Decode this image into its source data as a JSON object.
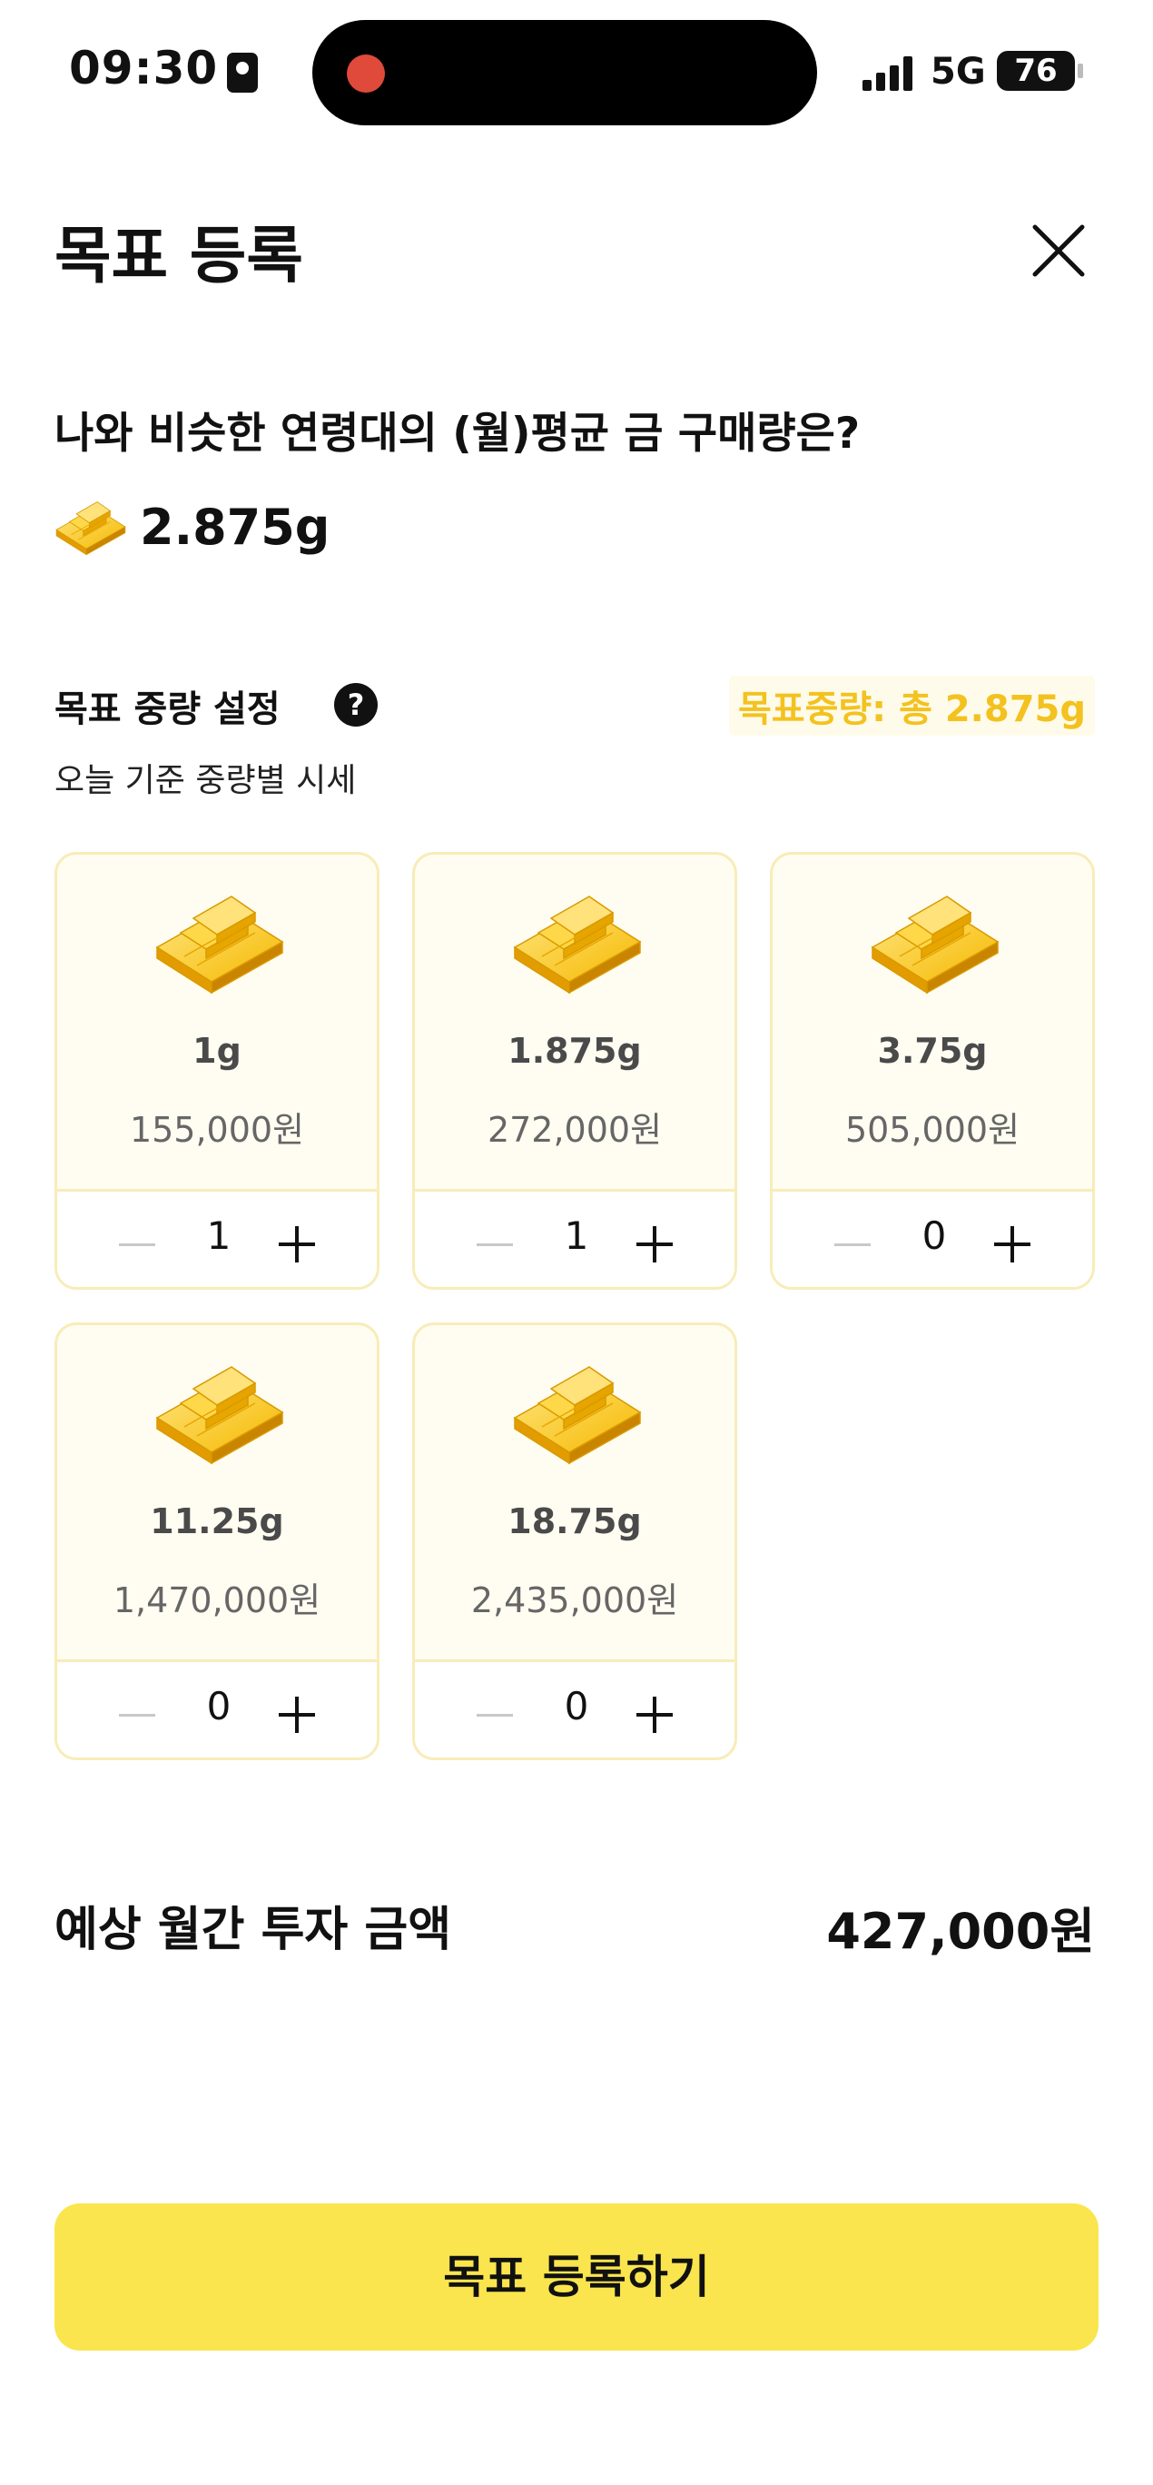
{
  "status_bar": {
    "time": "09:30",
    "network": "5G",
    "battery": "76"
  },
  "header": {
    "title": "목표 등록",
    "close_icon": "close-icon"
  },
  "average": {
    "question": "나와 비슷한 연령대의 (월)평균 금 구매량은?",
    "value": "2.875g"
  },
  "target": {
    "label": "목표 중량 설정",
    "help_icon": "?",
    "total": "목표중량: 총 2.875g",
    "subtitle": "오늘 기준 중량별 시세"
  },
  "items": [
    {
      "weight": "1g",
      "price": "155,000원",
      "quantity": "1"
    },
    {
      "weight": "1.875g",
      "price": "272,000원",
      "quantity": "1"
    },
    {
      "weight": "3.75g",
      "price": "505,000원",
      "quantity": "0"
    },
    {
      "weight": "11.25g",
      "price": "1,470,000원",
      "quantity": "0"
    },
    {
      "weight": "18.75g",
      "price": "2,435,000원",
      "quantity": "0"
    }
  ],
  "estimate": {
    "label": "예상 월간 투자 금액",
    "value": "427,000원"
  },
  "cta": {
    "label": "목표 등록하기"
  },
  "colors": {
    "accent": "#fae54e",
    "gold_text": "#f3c21f",
    "card_bg": "#fffdf1",
    "card_border": "#f8ecb8"
  }
}
